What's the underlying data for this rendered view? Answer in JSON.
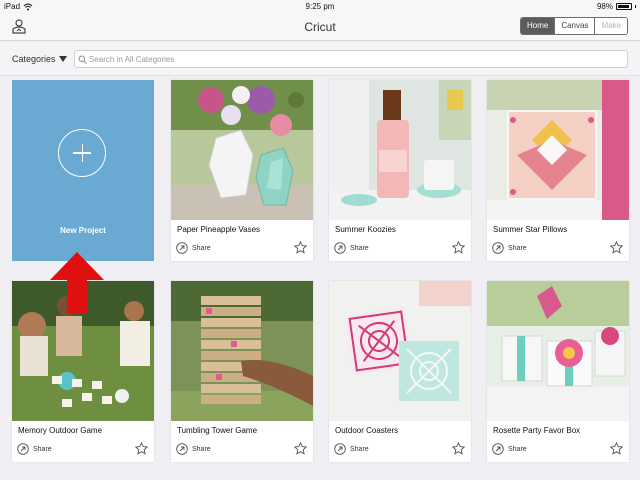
{
  "status_bar": {
    "carrier": "iPad",
    "time": "9:25 pm",
    "battery": "98%"
  },
  "nav": {
    "title": "Cricut",
    "segments": [
      {
        "label": "Home",
        "state": "active"
      },
      {
        "label": "Canvas",
        "state": "normal"
      },
      {
        "label": "Make",
        "state": "disabled"
      }
    ]
  },
  "search": {
    "categories_label": "Categories",
    "placeholder": "Search in All Categories"
  },
  "new_project": {
    "label": "New Project",
    "color": "#6aa9d2"
  },
  "annotation": {
    "arrow_color": "#e01010"
  },
  "projects": [
    {
      "title": "Paper Pineapple Vases",
      "share": "Share"
    },
    {
      "title": "Summer Koozies",
      "share": "Share"
    },
    {
      "title": "Summer Star Pillows",
      "share": "Share"
    },
    {
      "title": "Memory Outdoor Game",
      "share": "Share"
    },
    {
      "title": "Tumbling Tower Game",
      "share": "Share"
    },
    {
      "title": "Outdoor Coasters",
      "share": "Share"
    },
    {
      "title": "Rosette Party Favor Box",
      "share": "Share"
    }
  ]
}
